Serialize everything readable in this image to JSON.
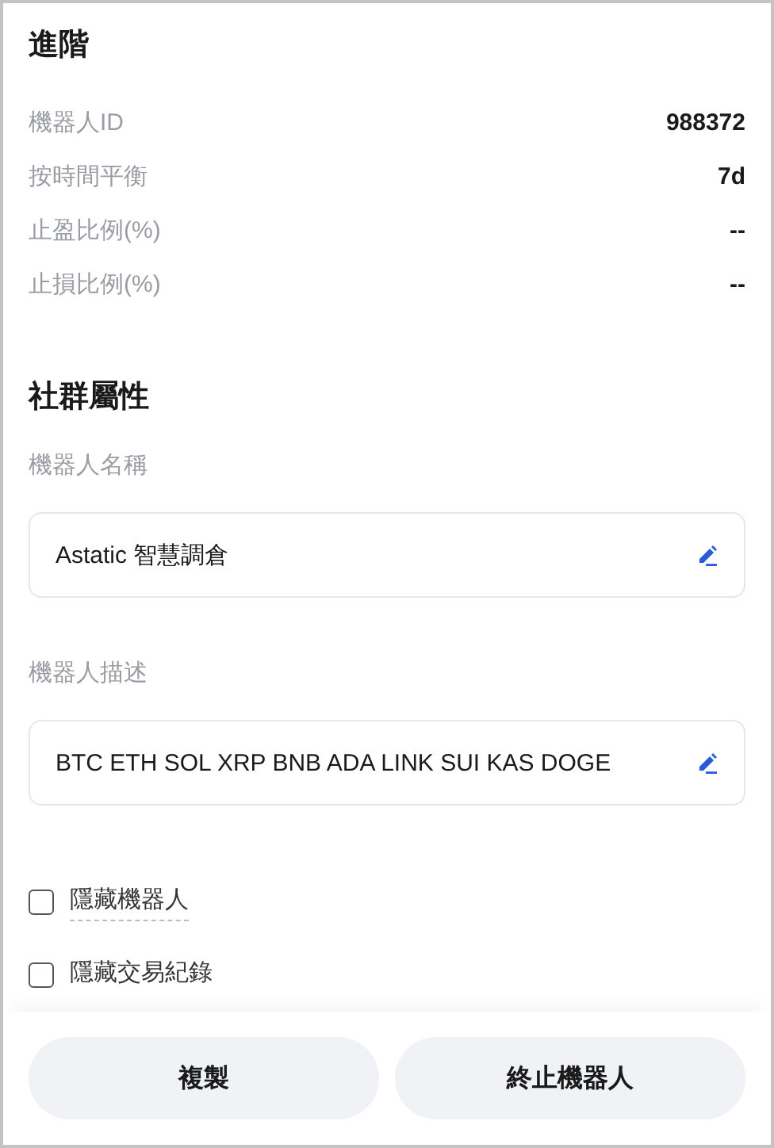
{
  "advanced": {
    "title": "進階",
    "rows": [
      {
        "label": "機器人ID",
        "value": "988372"
      },
      {
        "label": "按時間平衡",
        "value": "7d"
      },
      {
        "label": "止盈比例(%)",
        "value": "--"
      },
      {
        "label": "止損比例(%)",
        "value": "--"
      }
    ]
  },
  "social": {
    "title": "社群屬性",
    "fields": [
      {
        "label": "機器人名稱",
        "value": "Astatic 智慧調倉"
      },
      {
        "label": "機器人描述",
        "value": "BTC ETH SOL XRP BNB ADA LINK SUI KAS DOGE"
      }
    ],
    "checkboxes": [
      {
        "label": "隱藏機器人",
        "checked": false,
        "dashed_underline": true
      },
      {
        "label": "隱藏交易紀錄",
        "checked": false,
        "dashed_underline": false
      }
    ]
  },
  "buttons": [
    "複製",
    "終止機器人"
  ]
}
